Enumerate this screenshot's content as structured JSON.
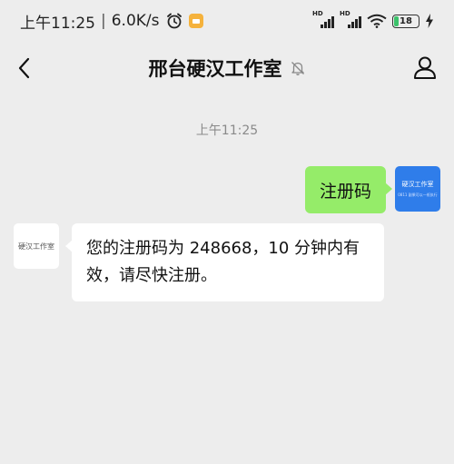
{
  "status_bar": {
    "time": "上午11:25",
    "separator": "|",
    "speed": "6.0K/s",
    "battery": "18",
    "network_label_1": "HD",
    "network_label_2": "HD"
  },
  "header": {
    "title": "邢台硬汉工作室"
  },
  "chat": {
    "timestamp": "上午11:25",
    "sent": {
      "text": "注册码",
      "avatar_name": "硬汉工作室",
      "avatar_sub": "0811 副果可以一纸执行"
    },
    "received": {
      "text": "您的注册码为 248668，10 分钟内有效，请尽快注册。",
      "avatar_name": "硬汉工作室"
    }
  },
  "colors": {
    "background": "#ededed",
    "sent_bubble": "#95ec69",
    "received_bubble": "#ffffff",
    "self_avatar": "#2f7dea",
    "battery_fill": "#3cc26b"
  },
  "icons": [
    "alarm-icon",
    "notification-icon",
    "signal-icon",
    "wifi-icon",
    "battery-icon",
    "charging-icon",
    "back-arrow-icon",
    "mute-bell-icon",
    "profile-icon"
  ]
}
